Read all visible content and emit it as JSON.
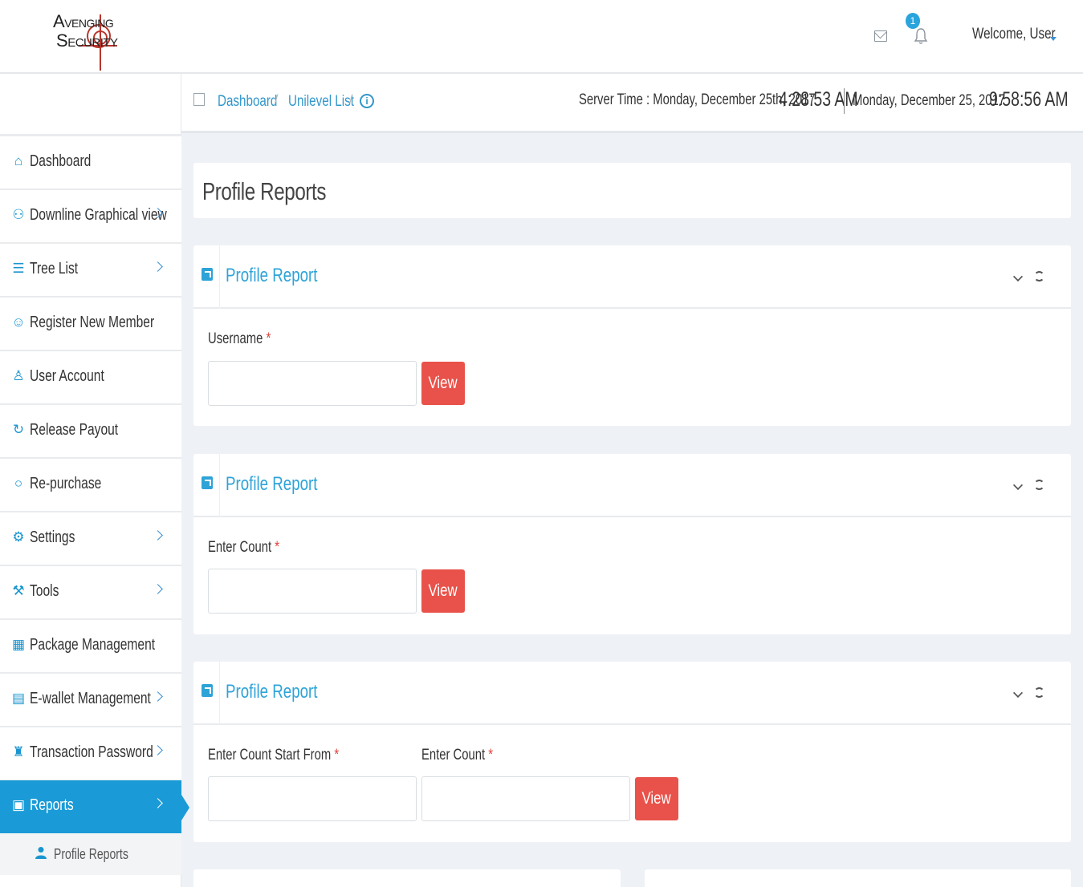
{
  "brand": {
    "line1": "VENGING",
    "line1_initial": "A",
    "line2": "ECURITY",
    "line2_initial": "S"
  },
  "header": {
    "notification_count": "1",
    "welcome": "Welcome, User",
    "icons": [
      "mail-icon",
      "bell-icon",
      "caret-down-icon"
    ]
  },
  "breadcrumb": {
    "items": [
      "Dashboard",
      "Unilevel List"
    ],
    "separator": "/",
    "info_icon": "i"
  },
  "clock": {
    "server_label": "Server Time : Monday, December 25th, 2017",
    "server_time": "4:28:53 AM",
    "local_date": "Monday, December 25, 2017",
    "local_time": "9:58:56 AM"
  },
  "sidebar": {
    "items": [
      {
        "label": "Dashboard",
        "icon": "home-icon",
        "glyph": "⌂",
        "has_children": false
      },
      {
        "label": "Downline Graphical view",
        "icon": "sitemap-icon",
        "glyph": "⚇",
        "has_children": true
      },
      {
        "label": "Tree List",
        "icon": "list-icon",
        "glyph": "☰",
        "has_children": true
      },
      {
        "label": "Register New Member",
        "icon": "user-plus-icon",
        "glyph": "☺",
        "has_children": false
      },
      {
        "label": "User Account",
        "icon": "user-icon",
        "glyph": "♙",
        "has_children": false
      },
      {
        "label": "Release Payout",
        "icon": "refresh-icon",
        "glyph": "↻",
        "has_children": false
      },
      {
        "label": "Re-purchase",
        "icon": "circle-notch-icon",
        "glyph": "○",
        "has_children": false
      },
      {
        "label": "Settings",
        "icon": "gear-icon",
        "glyph": "⚙",
        "has_children": true
      },
      {
        "label": "Tools",
        "icon": "wrench-icon",
        "glyph": "⚒",
        "has_children": true
      },
      {
        "label": "Package Management",
        "icon": "grid-icon",
        "glyph": "▦",
        "has_children": false
      },
      {
        "label": "E-wallet Management",
        "icon": "calendar-icon",
        "glyph": "▤",
        "has_children": true
      },
      {
        "label": "Transaction Password",
        "icon": "keyhole-icon",
        "glyph": "♜",
        "has_children": true
      },
      {
        "label": "Reports",
        "icon": "report-icon",
        "glyph": "▣",
        "has_children": true,
        "active": true
      }
    ],
    "sub_item": {
      "label": "Profile Reports",
      "icon": "user-icon"
    }
  },
  "page": {
    "title": "Profile Reports",
    "portlets": [
      {
        "title": "Profile Report",
        "fields": [
          {
            "label": "Username",
            "required": "*",
            "value": ""
          }
        ],
        "button": "View"
      },
      {
        "title": "Profile Report",
        "fields": [
          {
            "label": "Enter Count",
            "required": "*",
            "value": ""
          }
        ],
        "button": "View"
      },
      {
        "title": "Profile Report",
        "fields": [
          {
            "label": "Enter Count Start From",
            "required": "*",
            "value": ""
          },
          {
            "label": "Enter Count",
            "required": "*",
            "value": ""
          }
        ],
        "button": "View"
      }
    ]
  },
  "colors": {
    "accent": "#1a9bd7",
    "link": "#3197cb",
    "button": "#e8524a",
    "required": "#e0403a",
    "background": "#eef1f5"
  }
}
